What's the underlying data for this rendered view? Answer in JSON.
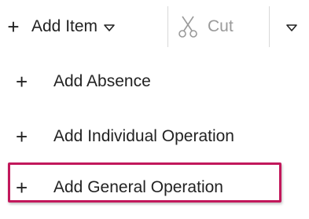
{
  "toolbar": {
    "add_item": {
      "plus_glyph": "+",
      "label": "Add Item",
      "caret_icon": "caret-down-icon"
    },
    "cut": {
      "icon": "scissors-icon",
      "label": "Cut",
      "enabled": false
    },
    "more": {
      "caret_icon": "caret-down-icon"
    }
  },
  "menu": {
    "items": [
      {
        "plus_glyph": "+",
        "label": "Add Absence"
      },
      {
        "plus_glyph": "+",
        "label": "Add Individual Operation"
      },
      {
        "plus_glyph": "+",
        "label": "Add General Operation",
        "highlighted": true
      }
    ]
  },
  "colors": {
    "text": "#222222",
    "disabled_text": "#9a9a9a",
    "highlight_border": "#c2185b",
    "separator": "#d8d8d8"
  }
}
